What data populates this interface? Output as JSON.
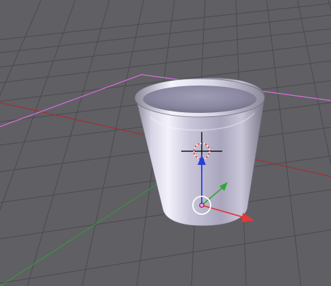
{
  "viewport": {
    "background_color": "#5f5f64",
    "grid_color": "#4a4a4e",
    "x_axis_color": "#b3262a",
    "y_axis_color": "#2fa33a",
    "selection_outline_color": "#e06ee0"
  },
  "scene": {
    "object": {
      "name": "",
      "base_color": "#b7b4c8",
      "highlight_color": "#eceaf6",
      "shadow_color": "#7c7a8a"
    },
    "cursor_icon": "3d-cursor-icon",
    "pivot_icon": "object-origin-icon",
    "manipulator_icon": "transform-manipulator-icon",
    "manipulator_colors": {
      "x": "#e03a3a",
      "y": "#2ea832",
      "z": "#2740d8"
    }
  }
}
